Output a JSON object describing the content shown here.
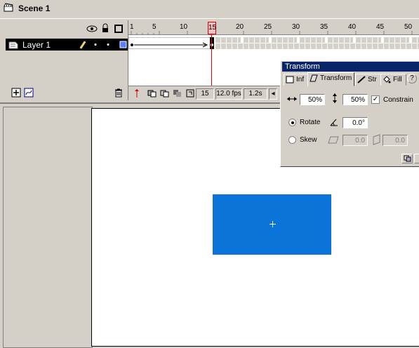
{
  "scene": {
    "label": "Scene 1"
  },
  "timeline": {
    "layer_name": "Layer 1",
    "ruler_ticks": [
      "1",
      "5",
      "10",
      "15",
      "20",
      "25",
      "30",
      "35",
      "40",
      "45",
      "50"
    ],
    "current_frame": "15",
    "frame_rate": "12.0 fps",
    "elapsed": "1.2s"
  },
  "transform_panel": {
    "title": "Transform",
    "tabs": [
      "Inf",
      "Transform",
      "Str",
      "Fill"
    ],
    "help": "?",
    "width_value": "50%",
    "height_value": "50%",
    "constrain_label": "Constrain",
    "rotate_label": "Rotate",
    "rotate_value": "0.0°",
    "skew_label": "Skew",
    "skew_h_value": "0.0",
    "skew_v_value": "0.0"
  },
  "colors": {
    "shape_fill": "#0a74d8",
    "playhead": "#dd0000",
    "panel_title_bg": "#0a246a"
  }
}
